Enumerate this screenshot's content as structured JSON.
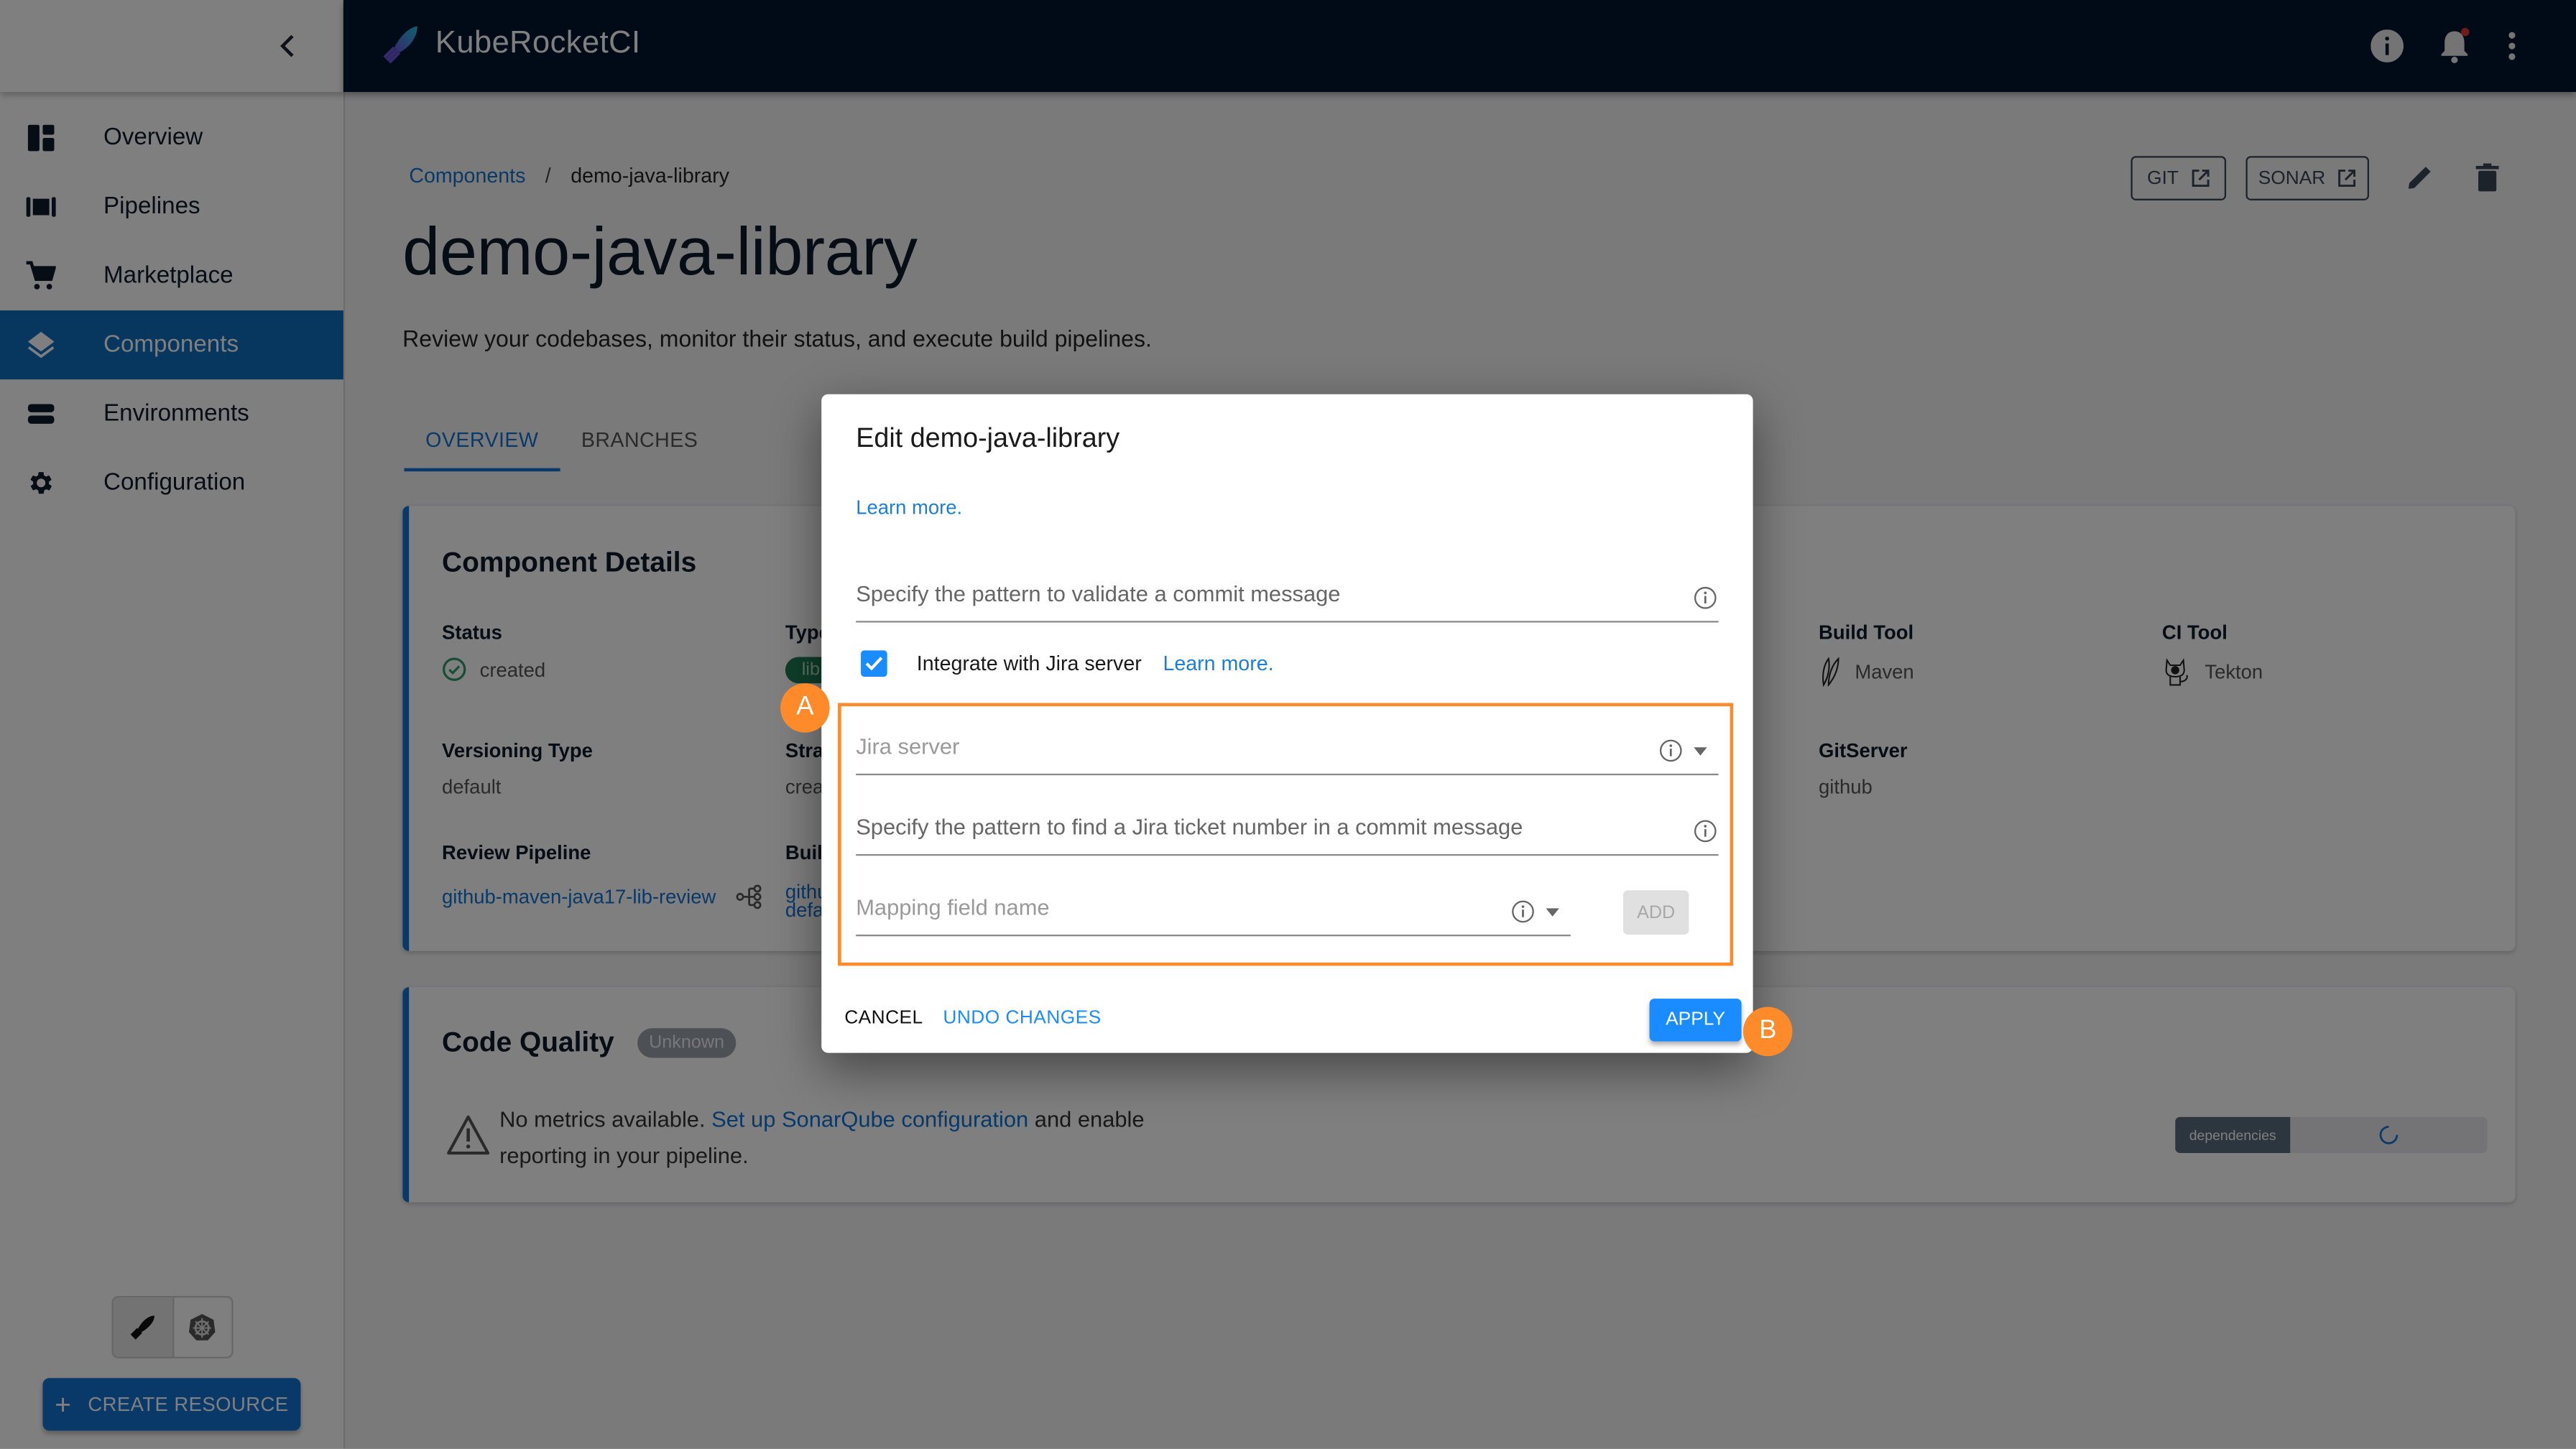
{
  "app": {
    "name": "KubeRocketCI"
  },
  "sidebar": {
    "collapse_icon": "chevron-left-icon",
    "items": [
      {
        "label": "Overview",
        "icon": "dashboard-icon",
        "active": false
      },
      {
        "label": "Pipelines",
        "icon": "pipelines-icon",
        "active": false
      },
      {
        "label": "Marketplace",
        "icon": "cart-icon",
        "active": false
      },
      {
        "label": "Components",
        "icon": "layers-icon",
        "active": true
      },
      {
        "label": "Environments",
        "icon": "environments-icon",
        "active": false
      },
      {
        "label": "Configuration",
        "icon": "gear-icon",
        "active": false
      }
    ],
    "theme_toggle": [
      "krci-mode-icon",
      "kubernetes-mode-icon"
    ],
    "create_button": "CREATE RESOURCE"
  },
  "header": {
    "icons": [
      "info-icon",
      "notification-bell-icon",
      "more-vert-icon"
    ],
    "notification_dot_color": "#e53935"
  },
  "breadcrumb": {
    "parent": "Components",
    "separator": "/",
    "current": "demo-java-library"
  },
  "page": {
    "title": "demo-java-library",
    "subtitle": "Review your codebases, monitor their status, and execute build pipelines."
  },
  "tabs": [
    {
      "label": "OVERVIEW",
      "active": true
    },
    {
      "label": "BRANCHES",
      "active": false
    }
  ],
  "actions": {
    "git": "GIT",
    "sonar": "SONAR"
  },
  "component_details": {
    "title": "Component Details",
    "fields": {
      "status": {
        "label": "Status",
        "value": "created"
      },
      "type": {
        "label": "Type",
        "value": "lib"
      },
      "versioning": {
        "label": "Versioning Type",
        "value": "default"
      },
      "strategy": {
        "label": "Strategy",
        "value": "create"
      },
      "review_pipeline": {
        "label": "Review Pipeline",
        "value": "github-maven-java17-lib-review"
      },
      "build_pipeline": {
        "label": "Build Pipeline",
        "value_line1": "github",
        "value_line2": "default"
      },
      "build_tool": {
        "label": "Build Tool",
        "value": "Maven"
      },
      "ci_tool": {
        "label": "CI Tool",
        "value": "Tekton"
      },
      "git_server": {
        "label": "GitServer",
        "value": "github"
      }
    }
  },
  "code_quality": {
    "title": "Code Quality",
    "badge": "Unknown",
    "message_before": "No metrics available.",
    "message_link": "Set up SonarQube configuration",
    "message_after": "and enable",
    "message_line2": "reporting in your pipeline.",
    "dependencies_label": "dependencies"
  },
  "dialog": {
    "title": "Edit demo-java-library",
    "learn_more": "Learn more.",
    "commit_pattern_placeholder": "Specify the pattern to validate a commit message",
    "jira_checkbox_label": "Integrate with Jira server",
    "jira_checkbox_checked": true,
    "jira_learn_more": "Learn more.",
    "jira_server_placeholder": "Jira server",
    "jira_ticket_pattern_placeholder": "Specify the pattern to find a Jira ticket number in a commit message",
    "mapping_field_placeholder": "Mapping field name",
    "add_button": "ADD",
    "cancel_button": "CANCEL",
    "undo_button": "UNDO CHANGES",
    "apply_button": "APPLY"
  },
  "annotations": {
    "marker_a": "A",
    "marker_b": "B",
    "color": "#ff8a2a"
  }
}
